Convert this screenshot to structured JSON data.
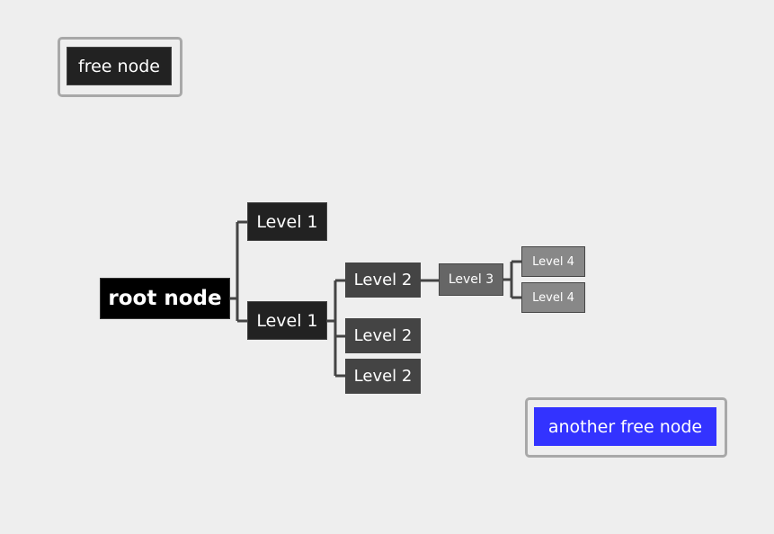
{
  "colors": {
    "background": "#eeeeee",
    "root": "#000000",
    "level1": "#222222",
    "level2": "#444444",
    "level3": "#666666",
    "level4": "#888888",
    "connector": "#444444",
    "free_node": "#222222",
    "another_free_node": "#3333ff",
    "frame": "#a8a8a8"
  },
  "free_nodes": [
    {
      "label": "free node"
    },
    {
      "label": "another free node"
    }
  ],
  "root": {
    "label": "root node"
  },
  "nodes": {
    "l1a": "Level 1",
    "l1b": "Level 1",
    "l2a": "Level 2",
    "l2b": "Level 2",
    "l2c": "Level 2",
    "l3": "Level 3",
    "l4a": "Level 4",
    "l4b": "Level 4"
  }
}
